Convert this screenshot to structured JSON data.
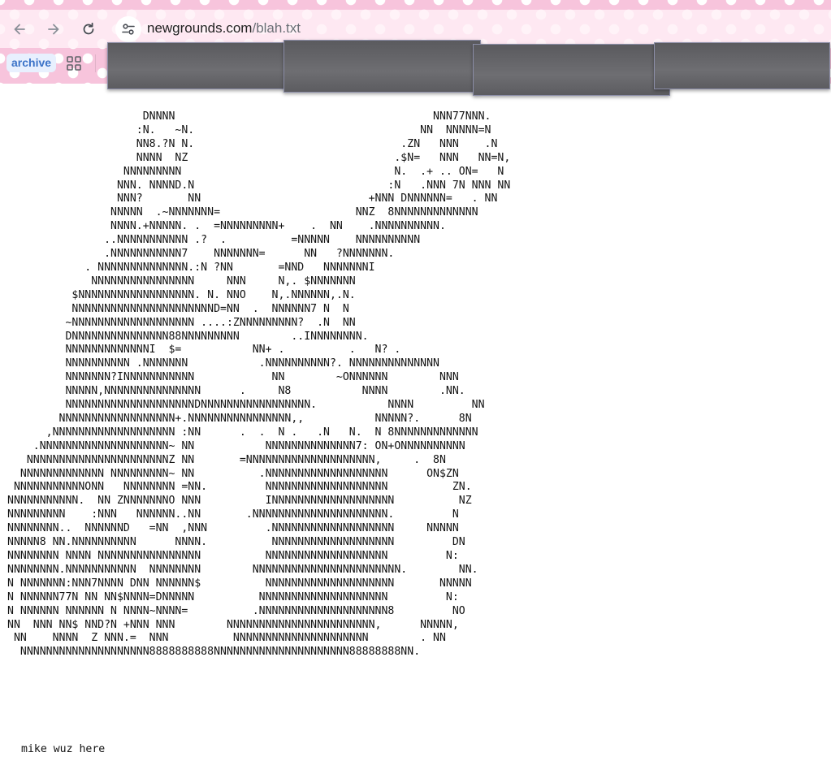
{
  "browser": {
    "url_host": "newgrounds.com",
    "url_path": "/blah.txt",
    "icons": {
      "back": "arrow-left-icon",
      "forward": "arrow-right-icon",
      "reload": "reload-icon",
      "site_info": "tune-icon",
      "apps": "apps-grid-icon"
    },
    "bookmarks": [
      {
        "label": "archive"
      }
    ]
  },
  "page": {
    "ascii_art": [
      "                     DNNNN                                        NNN77NNN.",
      "                    :N.   ~N.                                   NN  NNNNN=N",
      "                    NN8.?N N.                                .ZN   NNN    .N",
      "                    NNNN  NZ                                .$N=   NNN   NN=N,",
      "                  NNNNNNNNN                                 N.  .+ .. ON=   N",
      "                 NNN. NNNND.N                              :N   .NNN 7N NNN NN",
      "                 NNN?       NN                          +NNN DNNNNNN=   . NN",
      "                NNNNN  .~NNNNNNN=                     NNZ  8NNNNNNNNNNNNN",
      "                NNNN.+NNNNN. .  =NNNNNNNNN+    .  NN    .NNNNNNNNNN.",
      "               ..NNNNNNNNNNN .?  .          =NNNNN    NNNNNNNNNN",
      "               .NNNNNNNNNNN7    NNNNNNN=      NN   ?NNNNNNN.",
      "            . NNNNNNNNNNNNNN.:N ?NN       =NND   NNNNNNNI",
      "             NNNNNNNNNNNNNNNN     NNN     N,. $NNNNNNN",
      "          $NNNNNNNNNNNNNNNNNN. N. NNO    N,.NNNNNN,.N.",
      "          NNNNNNNNNNNNNNNNNNNNNND=NN  .  NNNNNN7 N  N",
      "         ~NNNNNNNNNNNNNNNNNNN ....:ZNNNNNNNNN?  .N  NN",
      "         DNNNNNNNNNNNNNNN88NNNNNNNNN        ..INNNNNNNN.",
      "         NNNNNNNNNNNNNI  $=           NN+ .          .   N? .",
      "         NNNNNNNNNN .NNNNNNN           .NNNNNNNNNN?. NNNNNNNNNNNNNN",
      "         NNNNNNN?INNNNNNNNNNN            NN        ~ONNNNNN        NNN",
      "         NNNNN,NNNNNNNNNNNNNNN      .     N8           NNNN        .NN.",
      "         NNNNNNNNNNNNNNNNNNNNDNNNNNNNNNNNNNNNNN.           NNNN         NN",
      "        NNNNNNNNNNNNNNNNNN+.NNNNNNNNNNNNNNNN,,           NNNNN?.      8N",
      "      ,NNNNNNNNNNNNNNNNNNN :NN      .  .  N .   .N   N.  N 8NNNNNNNNNNNNN",
      "    .NNNNNNNNNNNNNNNNNNNN~ NN           NNNNNNNNNNNNNN7: ON+ONNNNNNNNNN",
      "   NNNNNNNNNNNNNNNNNNNNNNZ NN       =NNNNNNNNNNNNNNNNNNNN,     .  8N",
      "  NNNNNNNNNNNNN NNNNNNNNN~ NN          .NNNNNNNNNNNNNNNNNNN      ON$ZN",
      " NNNNNNNNNNNONN   NNNNNNNN =NN.         NNNNNNNNNNNNNNNNNNN          ZN.",
      "NNNNNNNNNNN.  NN ZNNNNNNNO NNN          INNNNNNNNNNNNNNNNNNN          NZ",
      "NNNNNNNNN    :NNN   NNNNNN..NN       .NNNNNNNNNNNNNNNNNNNNN.         N",
      "NNNNNNNN..  NNNNNND   =NN  ,NNN         .NNNNNNNNNNNNNNNNNNN     NNNNN",
      "NNNNN8 NN.NNNNNNNNNN      NNNN.          NNNNNNNNNNNNNNNNNNN         DN",
      "NNNNNNNN NNNN NNNNNNNNNNNNNNNN          NNNNNNNNNNNNNNNNNNN         N:",
      "NNNNNNNN.NNNNNNNNNNN  NNNNNNNN        NNNNNNNNNNNNNNNNNNNNNNN.        NN.",
      "N NNNNNNN:NNN7NNNN DNN NNNNNN$          NNNNNNNNNNNNNNNNNNNN       NNNNN",
      "N NNNNNN77N NN NN$NNNN=DNNNNN          NNNNNNNNNNNNNNNNNNNN         N:",
      "N NNNNNN NNNNNN N NNNN~NNNN=          .NNNNNNNNNNNNNNNNNNNN8         NO",
      "NN  NNN NN$ NND?N +NNN NNN        NNNNNNNNNNNNNNNNNNNNNNN,      NNNNN,",
      " NN    NNNN  Z NNN.=  NNN          NNNNNNNNNNNNNNNNNNNNN        . NN",
      "  NNNNNNNNNNNNNNNNNNNN8888888888NNNNNNNNNNNNNNNNNNNNN88888888NN."
    ],
    "signature": "mike wuz here"
  }
}
